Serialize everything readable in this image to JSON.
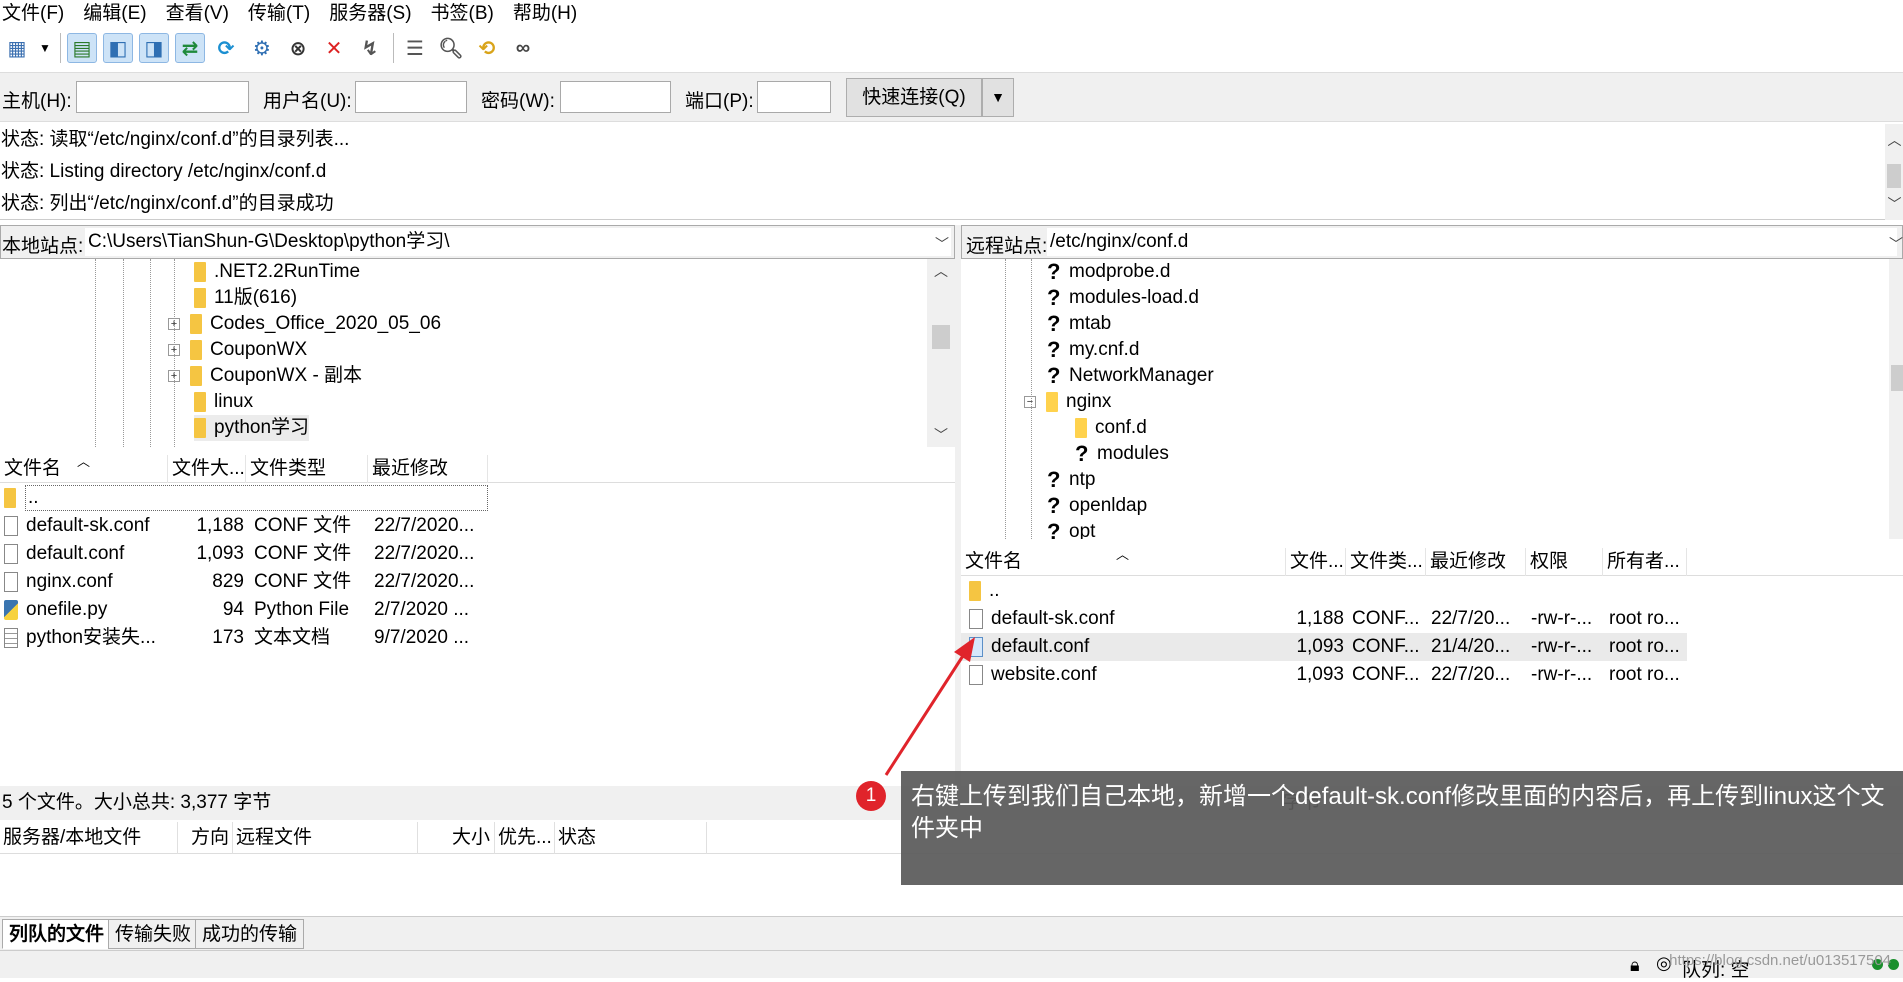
{
  "menu": [
    "文件(F)",
    "编辑(E)",
    "查看(V)",
    "传输(T)",
    "服务器(S)",
    "书签(B)",
    "帮助(H)"
  ],
  "quickconnect": {
    "host_label": "主机(H):",
    "user_label": "用户名(U):",
    "pass_label": "密码(W):",
    "port_label": "端口(P):",
    "connect_label": "快速连接(Q)",
    "dropdown": "▼"
  },
  "log": [
    "状态:  读取“/etc/nginx/conf.d”的目录列表...",
    "状态:  Listing directory /etc/nginx/conf.d",
    "状态:  列出“/etc/nginx/conf.d”的目录成功"
  ],
  "local": {
    "site_label": "本地站点:",
    "path": "C:\\Users\\TianShun-G\\Desktop\\python学习\\",
    "tree": [
      {
        "name": ".NET2.2RunTime",
        "expandable": false
      },
      {
        "name": "11版(616)",
        "expandable": false
      },
      {
        "name": "Codes_Office_2020_05_06",
        "expandable": true
      },
      {
        "name": "CouponWX",
        "expandable": true
      },
      {
        "name": "CouponWX - 副本",
        "expandable": true
      },
      {
        "name": "linux",
        "expandable": false
      },
      {
        "name": "python学习",
        "expandable": false
      }
    ],
    "columns": [
      "文件名",
      "文件大...",
      "文件类型",
      "最近修改"
    ],
    "parent": "..",
    "files": [
      {
        "name": "default-sk.conf",
        "size": "1,188",
        "type": "CONF 文件",
        "modified": "22/7/2020..."
      },
      {
        "name": "default.conf",
        "size": "1,093",
        "type": "CONF 文件",
        "modified": "22/7/2020..."
      },
      {
        "name": "nginx.conf",
        "size": "829",
        "type": "CONF 文件",
        "modified": "22/7/2020..."
      },
      {
        "name": "onefile.py",
        "size": "94",
        "type": "Python File",
        "modified": "2/7/2020 ..."
      },
      {
        "name": "python安装失...",
        "size": "173",
        "type": "文本文档",
        "modified": "9/7/2020 ..."
      }
    ],
    "summary": "5 个文件。大小总共: 3,377 字节"
  },
  "remote": {
    "site_label": "远程站点:",
    "path": "/etc/nginx/conf.d",
    "tree": [
      {
        "name": "modprobe.d",
        "kind": "unknown",
        "level": 1
      },
      {
        "name": "modules-load.d",
        "kind": "unknown",
        "level": 1
      },
      {
        "name": "mtab",
        "kind": "unknown",
        "level": 1
      },
      {
        "name": "my.cnf.d",
        "kind": "unknown",
        "level": 1
      },
      {
        "name": "NetworkManager",
        "kind": "unknown",
        "level": 1
      },
      {
        "name": "nginx",
        "kind": "folder-open",
        "level": 1
      },
      {
        "name": "conf.d",
        "kind": "folder",
        "level": 2
      },
      {
        "name": "modules",
        "kind": "unknown",
        "level": 2
      },
      {
        "name": "ntp",
        "kind": "unknown",
        "level": 1
      },
      {
        "name": "openldap",
        "kind": "unknown",
        "level": 1
      },
      {
        "name": "opt",
        "kind": "unknown",
        "level": 1
      }
    ],
    "columns": [
      "文件名",
      "文件...",
      "文件类...",
      "最近修改",
      "权限",
      "所有者..."
    ],
    "parent": "..",
    "files": [
      {
        "name": "default-sk.conf",
        "size": "1,188",
        "type": "CONF...",
        "modified": "22/7/20...",
        "perm": "-rw-r-...",
        "owner": "root ro..."
      },
      {
        "name": "default.conf",
        "size": "1,093",
        "type": "CONF...",
        "modified": "21/4/20...",
        "perm": "-rw-r-...",
        "owner": "root ro..."
      },
      {
        "name": "website.conf",
        "size": "1,093",
        "type": "CONF...",
        "modified": "22/7/20...",
        "perm": "-rw-r-...",
        "owner": "root ro..."
      }
    ],
    "summary_partial": "字节"
  },
  "queue": {
    "columns": [
      "服务器/本地文件",
      "方向",
      "远程文件",
      "大小",
      "优先...",
      "状态"
    ],
    "tabs": [
      "列队的文件",
      "传输失败",
      "成功的传输"
    ],
    "status": "队列: 空"
  },
  "annotation": {
    "number": "1",
    "text": "右键上传到我们自己本地，新增一个default-sk.conf修改里面的内容后，再上传到linux这个文件夹中",
    "color": "#e0242b"
  },
  "watermark": "https://blog.csdn.net/u013517504"
}
